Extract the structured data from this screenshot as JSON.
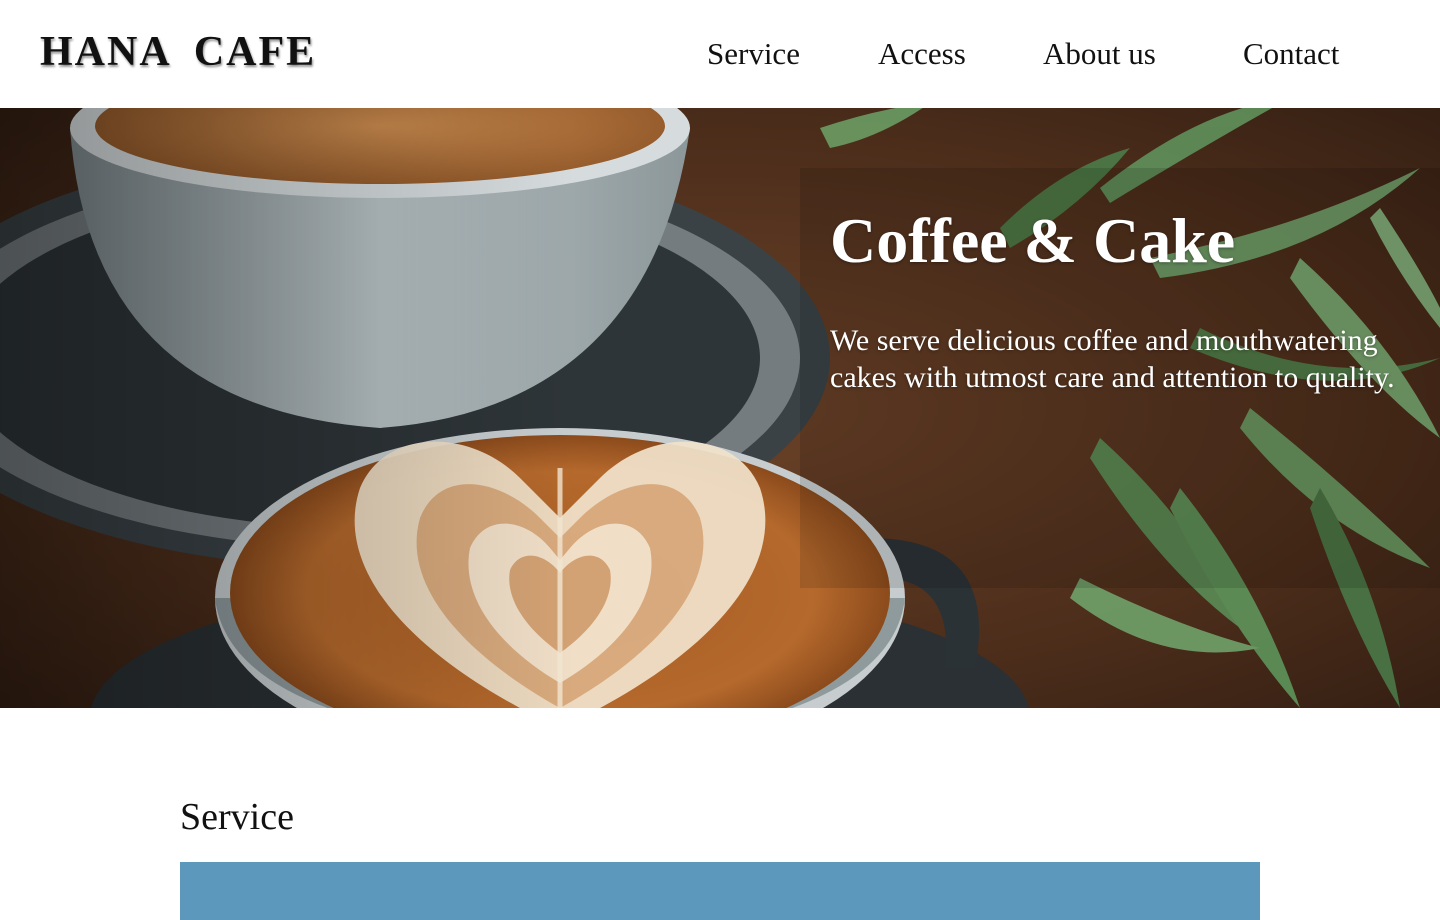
{
  "header": {
    "logo_text": "HANA  CAFE",
    "nav": [
      {
        "label": "Service"
      },
      {
        "label": "Access"
      },
      {
        "label": "About us"
      },
      {
        "label": "Contact"
      }
    ]
  },
  "hero": {
    "title": "Coffee & Cake",
    "text": "We serve delicious coffee and mouthwatering cakes with utmost care and attention to quality.",
    "image": "latte-art-coffee-cups-with-plant-photo"
  },
  "service": {
    "title": "Service",
    "banner_color": "#5b98bb"
  },
  "colors": {
    "text": "#111111",
    "hero_text": "#ffffff",
    "background": "#ffffff",
    "accent_blue": "#5b98bb"
  }
}
